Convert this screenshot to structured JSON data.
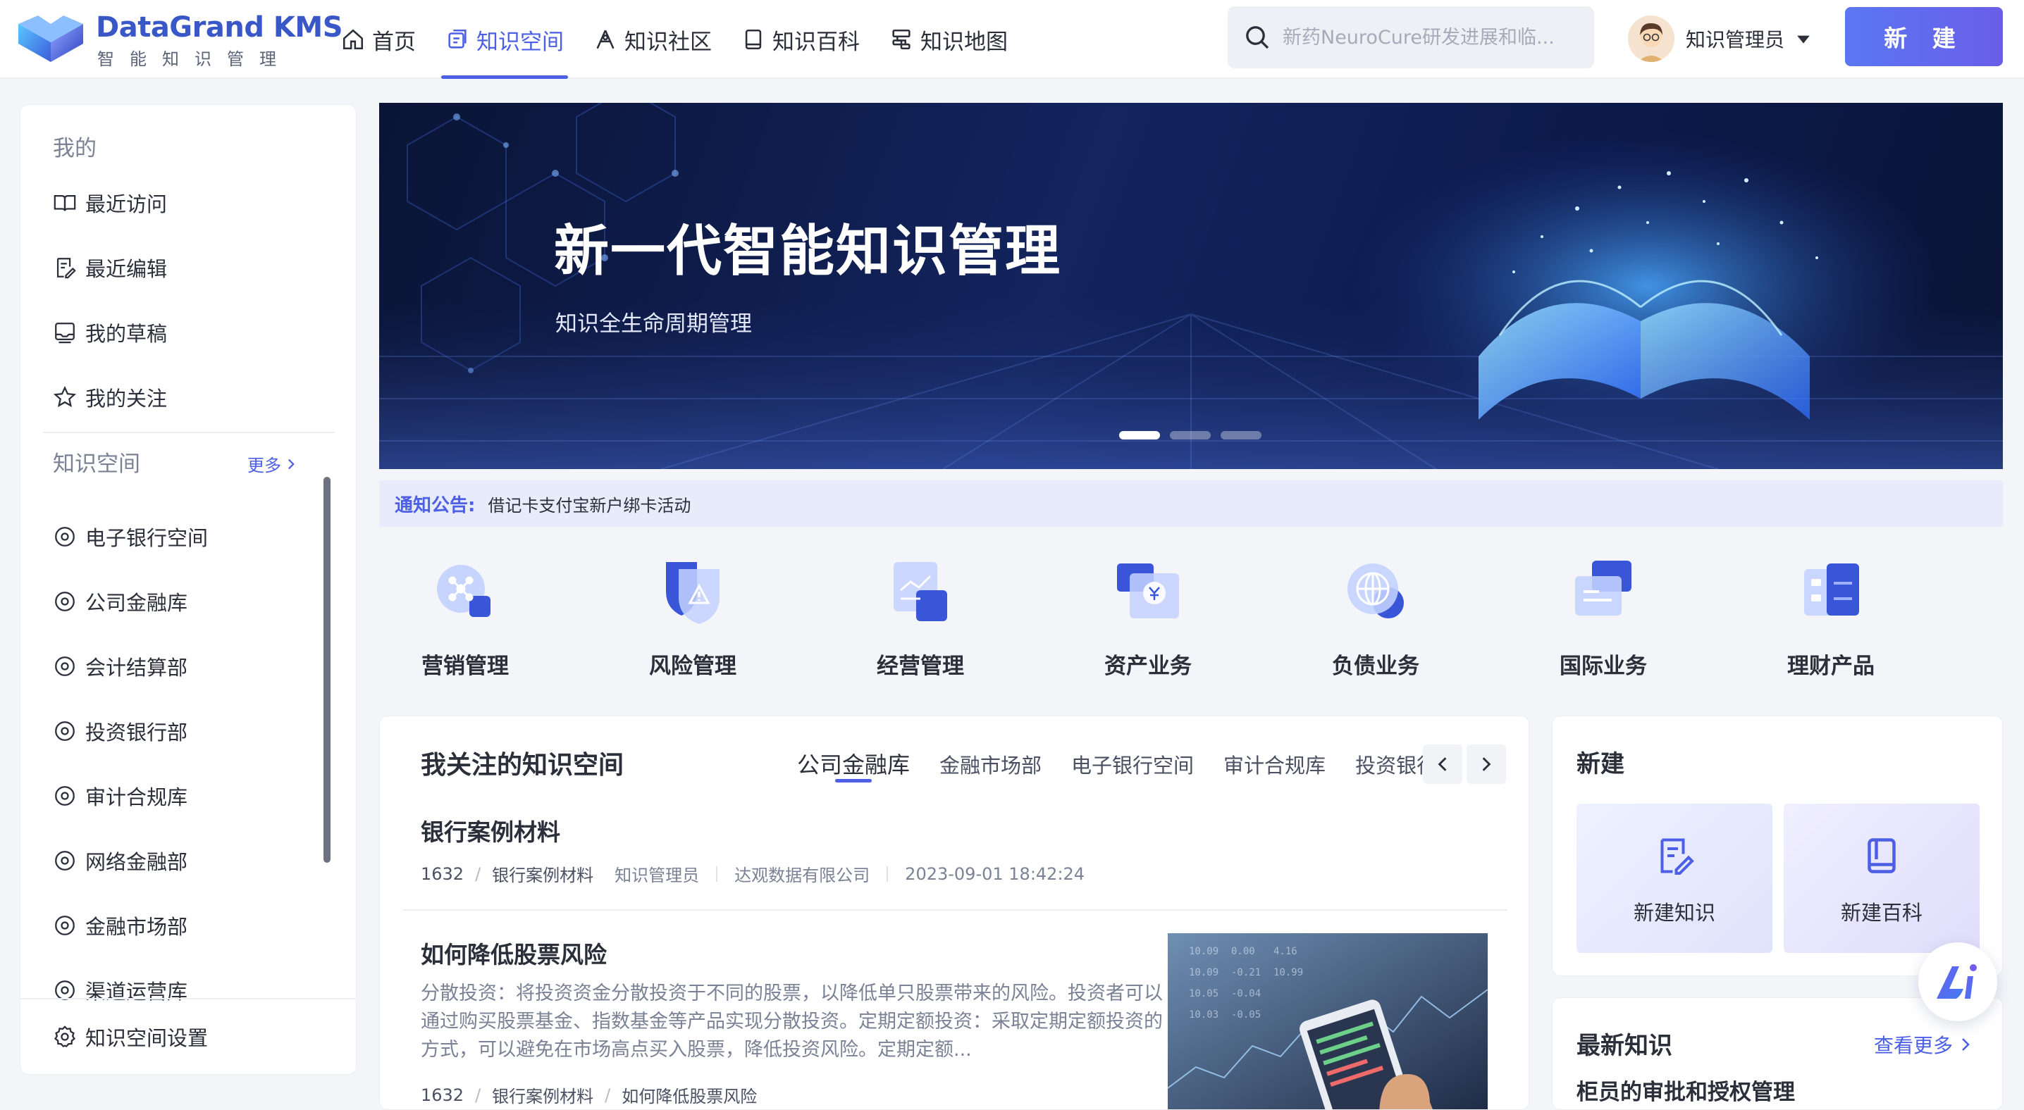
{
  "brand": {
    "name": "DataGrand KMS",
    "subtitle": "智能知识管理"
  },
  "nav": [
    {
      "label": "首页",
      "icon": "home-icon"
    },
    {
      "label": "知识空间",
      "icon": "space-icon",
      "active": true
    },
    {
      "label": "知识社区",
      "icon": "community-icon"
    },
    {
      "label": "知识百科",
      "icon": "book-icon"
    },
    {
      "label": "知识地图",
      "icon": "map-icon"
    }
  ],
  "search": {
    "placeholder": "新药NeuroCure研发进展和临..."
  },
  "user": {
    "name": "知识管理员"
  },
  "header_new_button": "新 建",
  "sidebar": {
    "mine_title": "我的",
    "mine_items": [
      {
        "label": "最近访问",
        "icon": "book-open-icon"
      },
      {
        "label": "最近编辑",
        "icon": "edit-doc-icon"
      },
      {
        "label": "我的草稿",
        "icon": "draft-icon"
      },
      {
        "label": "我的关注",
        "icon": "star-icon"
      }
    ],
    "spaces_title": "知识空间",
    "more_label": "更多",
    "spaces": [
      "电子银行空间",
      "公司金融库",
      "会计结算部",
      "投资银行部",
      "审计合规库",
      "网络金融部",
      "金融市场部",
      "渠道运营库"
    ],
    "settings_label": "知识空间设置"
  },
  "banner": {
    "title": "新一代智能知识管理",
    "subtitle": "知识全生命周期管理",
    "slide_count": 3,
    "active_slide": 1
  },
  "notice": {
    "label": "通知公告:",
    "text": "借记卡支付宝新户绑卡活动"
  },
  "categories": [
    {
      "label": "营销管理",
      "icon": "marketing-icon"
    },
    {
      "label": "风险管理",
      "icon": "risk-shield-icon"
    },
    {
      "label": "经营管理",
      "icon": "operation-chart-icon"
    },
    {
      "label": "资产业务",
      "icon": "asset-yuan-icon"
    },
    {
      "label": "负债业务",
      "icon": "liability-globe-icon"
    },
    {
      "label": "国际业务",
      "icon": "international-card-icon"
    },
    {
      "label": "理财产品",
      "icon": "wealth-product-icon"
    }
  ],
  "followed": {
    "title": "我关注的知识空间",
    "tabs": [
      "公司金融库",
      "金融市场部",
      "电子银行空间",
      "审计合规库",
      "投资银行部"
    ],
    "active_tab": 0,
    "articles": [
      {
        "title": "银行案例材料",
        "id": "1632",
        "category": "银行案例材料",
        "author": "知识管理员",
        "org": "达观数据有限公司",
        "time": "2023-09-01 18:42:24"
      },
      {
        "title": "如何降低股票风险",
        "body": "分散投资：将投资资金分散投资于不同的股票，以降低单只股票带来的风险。投资者可以通过购买股票基金、指数基金等产品实现分散投资。定期定额投资：采取定期定额投资的方式，可以避免在市场高点买入股票，降低投资风险。定期定额...",
        "id": "1632",
        "category": "银行案例材料",
        "sub": "如何降低股票风险"
      }
    ]
  },
  "new_panel": {
    "title": "新建",
    "tiles": [
      {
        "label": "新建知识",
        "icon": "new-knowledge-icon"
      },
      {
        "label": "新建百科",
        "icon": "new-wiki-icon"
      }
    ]
  },
  "latest": {
    "title": "最新知识",
    "more_label": "查看更多",
    "first_item": "柜员的审批和授权管理"
  },
  "colors": {
    "accent": "#4c5fe6",
    "banner_dark": "#0a1436",
    "notice_bg": "#e7ebfa"
  }
}
